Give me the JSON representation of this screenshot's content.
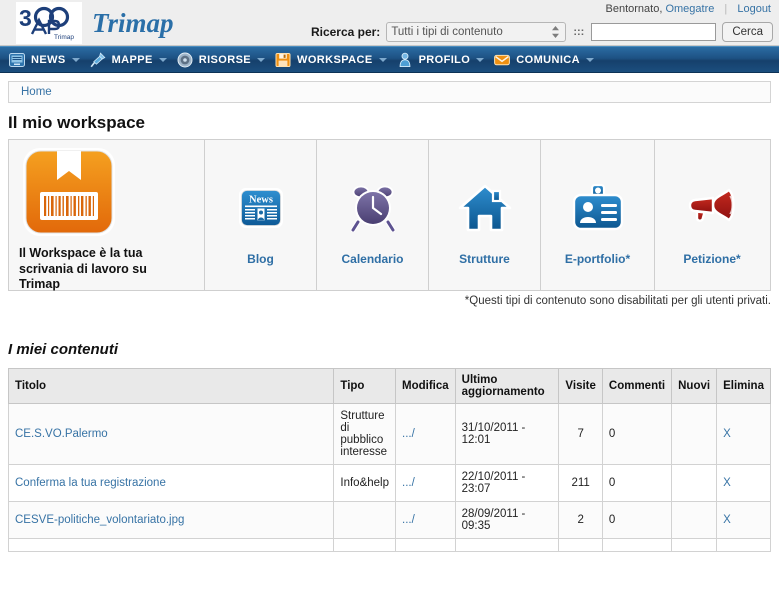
{
  "header": {
    "brand": "Trimap",
    "logo_icon": "trimap-3ap-logo",
    "welcome_prefix": "Bentornato,",
    "user": "Omegatre",
    "logout": "Logout",
    "search_label": "Ricerca per:",
    "content_type_selected": "Tutti i tipi di contenuto",
    "content_type_options": [
      "Tutti i tipi di contenuto"
    ],
    "dots_separator": ":::",
    "search_value": "",
    "search_placeholder": "",
    "search_button": "Cerca"
  },
  "nav": {
    "items": [
      {
        "label": "NEWS",
        "icon": "monitor-icon",
        "has_caret": true
      },
      {
        "label": "MAPPE",
        "icon": "pin-icon",
        "has_caret": true
      },
      {
        "label": "RISORSE",
        "icon": "wheel-icon",
        "has_caret": true
      },
      {
        "label": "WORKSPACE",
        "icon": "floppy-icon",
        "has_caret": true
      },
      {
        "label": "PROFILO",
        "icon": "person-icon",
        "has_caret": true
      },
      {
        "label": "COMUNICA",
        "icon": "envelope-icon",
        "has_caret": true
      }
    ]
  },
  "breadcrumb": {
    "items": [
      "Home"
    ]
  },
  "page": {
    "title": "Il mio workspace",
    "workspace_main_text": "Il Workspace è la tua scrivania di lavoro su Trimap",
    "workspace_main_icon": "orange-box-barcode-icon",
    "note": "*Questi tipi di contenuto sono disabilitati per gli utenti privati.",
    "tiles": [
      {
        "label": "Blog",
        "icon": "news-paper-icon"
      },
      {
        "label": "Calendario",
        "icon": "alarm-clock-icon"
      },
      {
        "label": "Strutture",
        "icon": "house-icon"
      },
      {
        "label": "E-portfolio*",
        "icon": "id-badge-icon"
      },
      {
        "label": "Petizione*",
        "icon": "megaphone-icon"
      }
    ]
  },
  "contents": {
    "title": "I miei contenuti",
    "columns": [
      "Titolo",
      "Tipo",
      "Modifica",
      "Ultimo aggiornamento",
      "Visite",
      "Commenti",
      "Nuovi",
      "Elimina"
    ],
    "rows": [
      {
        "titolo": "CE.S.VO.Palermo",
        "tipo": "Strutture di pubblico interesse",
        "modifica": ".../",
        "ultimo": "31/10/2011 - 12:01",
        "visite": "7",
        "commenti": "0",
        "nuovi": "",
        "elimina": "X"
      },
      {
        "titolo": "Conferma la tua registrazione",
        "tipo": "Info&help",
        "modifica": ".../",
        "ultimo": "22/10/2011 - 23:07",
        "visite": "211",
        "commenti": "0",
        "nuovi": "",
        "elimina": "X"
      },
      {
        "titolo": "CESVE-politiche_volontariato.jpg",
        "tipo": "",
        "modifica": ".../",
        "ultimo": "28/09/2011 - 09:35",
        "visite": "2",
        "commenti": "0",
        "nuovi": "",
        "elimina": "X"
      },
      {
        "titolo": "",
        "tipo": "",
        "modifica": "",
        "ultimo": "",
        "visite": "",
        "commenti": "",
        "nuovi": "",
        "elimina": ""
      }
    ]
  },
  "colors": {
    "nav_blue": "#1d5183",
    "link_blue": "#3773a5",
    "brand_blue": "#2a6fa8",
    "accent_orange": "#ee8f12",
    "accent_red": "#b91d1d",
    "accent_purple": "#5b4e86"
  }
}
